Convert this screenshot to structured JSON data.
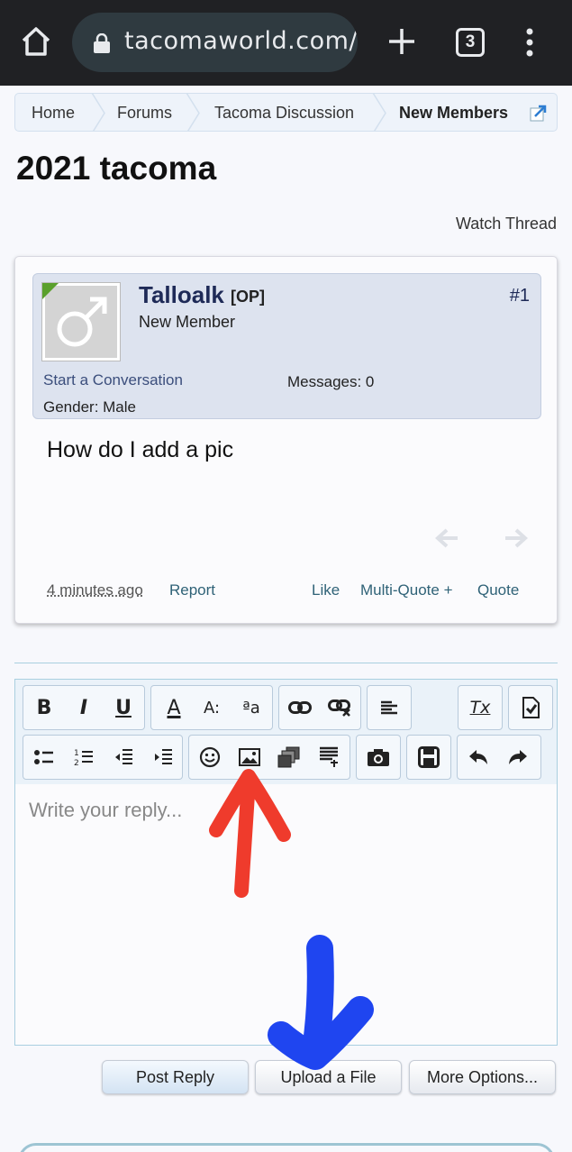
{
  "browser": {
    "url": "tacomaworld.com/tl",
    "tab_count": "3"
  },
  "breadcrumb": {
    "items": [
      {
        "label": "Home"
      },
      {
        "label": "Forums"
      },
      {
        "label": "Tacoma Discussion"
      },
      {
        "label": "New Members"
      }
    ]
  },
  "thread": {
    "title": "2021 tacoma",
    "watch_label": "Watch Thread"
  },
  "post": {
    "username": "Talloalk",
    "op_tag": "[OP]",
    "user_title": "New Member",
    "post_number": "#1",
    "start_conversation": "Start a Conversation",
    "messages_text": "Messages:  0",
    "gender_text": "Gender:  Male",
    "body": "How do I add a pic",
    "time": "4 minutes ago",
    "report": "Report",
    "like": "Like",
    "multiquote": "Multi-Quote +",
    "quote": "Quote"
  },
  "editor": {
    "placeholder": "Write your reply...",
    "toolbar": {
      "bold": "B",
      "italic": "I",
      "underline": "U",
      "font_color": "A",
      "font_size": "A:",
      "font_family": "ªa",
      "remove_format": "Tx"
    }
  },
  "actions": {
    "post_reply": "Post Reply",
    "upload_file": "Upload a File",
    "more_options": "More Options..."
  },
  "colors": {
    "annotation_red": "#ef3b2c",
    "annotation_blue": "#1f45f0",
    "username": "#1e2a57",
    "link": "#2f6277"
  }
}
